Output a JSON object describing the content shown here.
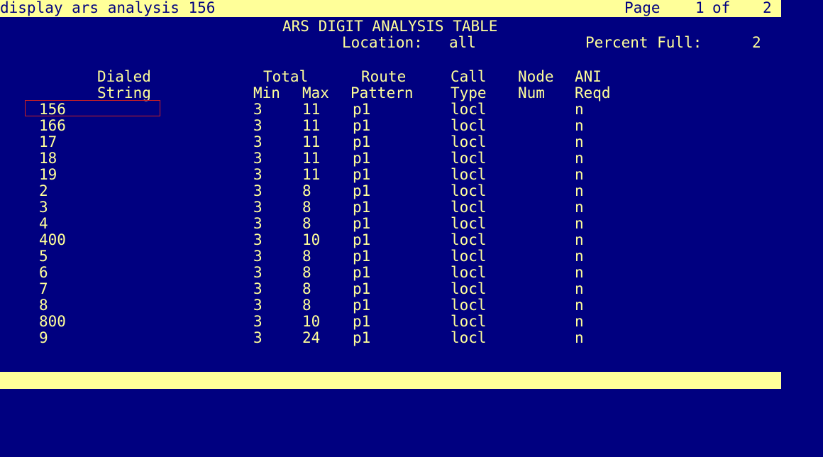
{
  "header": {
    "command": "display ars analysis 156",
    "page_label": "Page",
    "page_current": "1",
    "page_of": "of",
    "page_total": "2"
  },
  "form": {
    "title": "ARS DIGIT ANALYSIS TABLE",
    "location_label": "Location:",
    "location_value": "all",
    "percent_full_label": "Percent Full:",
    "percent_full_value": "2"
  },
  "columns": {
    "dialed": [
      "Dialed",
      "String"
    ],
    "total": [
      "Total",
      ""
    ],
    "min": [
      "",
      "Min"
    ],
    "max": [
      "",
      "Max"
    ],
    "route": [
      "Route",
      "Pattern"
    ],
    "call": [
      "Call",
      "Type"
    ],
    "node": [
      "Node",
      "Num"
    ],
    "ani": [
      "ANI",
      "Reqd"
    ]
  },
  "rows": [
    {
      "dialed": "156",
      "min": "3",
      "max": "11",
      "route": "p1",
      "call": "locl",
      "node": "",
      "ani": "n"
    },
    {
      "dialed": "166",
      "min": "3",
      "max": "11",
      "route": "p1",
      "call": "locl",
      "node": "",
      "ani": "n"
    },
    {
      "dialed": "17",
      "min": "3",
      "max": "11",
      "route": "p1",
      "call": "locl",
      "node": "",
      "ani": "n"
    },
    {
      "dialed": "18",
      "min": "3",
      "max": "11",
      "route": "p1",
      "call": "locl",
      "node": "",
      "ani": "n"
    },
    {
      "dialed": "19",
      "min": "3",
      "max": "11",
      "route": "p1",
      "call": "locl",
      "node": "",
      "ani": "n"
    },
    {
      "dialed": "2",
      "min": "3",
      "max": "8",
      "route": "p1",
      "call": "locl",
      "node": "",
      "ani": "n"
    },
    {
      "dialed": "3",
      "min": "3",
      "max": "8",
      "route": "p1",
      "call": "locl",
      "node": "",
      "ani": "n"
    },
    {
      "dialed": "4",
      "min": "3",
      "max": "8",
      "route": "p1",
      "call": "locl",
      "node": "",
      "ani": "n"
    },
    {
      "dialed": "400",
      "min": "3",
      "max": "10",
      "route": "p1",
      "call": "locl",
      "node": "",
      "ani": "n"
    },
    {
      "dialed": "5",
      "min": "3",
      "max": "8",
      "route": "p1",
      "call": "locl",
      "node": "",
      "ani": "n"
    },
    {
      "dialed": "6",
      "min": "3",
      "max": "8",
      "route": "p1",
      "call": "locl",
      "node": "",
      "ani": "n"
    },
    {
      "dialed": "7",
      "min": "3",
      "max": "8",
      "route": "p1",
      "call": "locl",
      "node": "",
      "ani": "n"
    },
    {
      "dialed": "8",
      "min": "3",
      "max": "8",
      "route": "p1",
      "call": "locl",
      "node": "",
      "ani": "n"
    },
    {
      "dialed": "800",
      "min": "3",
      "max": "10",
      "route": "p1",
      "call": "locl",
      "node": "",
      "ani": "n"
    },
    {
      "dialed": "9",
      "min": "3",
      "max": "24",
      "route": "p1",
      "call": "locl",
      "node": "",
      "ani": "n"
    }
  ],
  "colors": {
    "background": "#000080",
    "text": "#FFFF99",
    "status_bar": "#FFFF99",
    "highlight_border": "#D02020"
  }
}
